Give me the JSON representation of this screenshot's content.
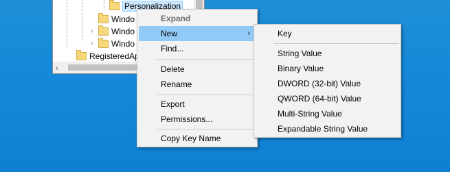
{
  "tree": {
    "items": [
      {
        "label": "Personalization"
      },
      {
        "label": "Windo"
      },
      {
        "label": "Windo"
      },
      {
        "label": "Windo"
      },
      {
        "label": "RegisteredAp"
      }
    ]
  },
  "context_menu": {
    "items": [
      {
        "label": "Expand"
      },
      {
        "label": "New"
      },
      {
        "label": "Find..."
      },
      {
        "label": "Delete"
      },
      {
        "label": "Rename"
      },
      {
        "label": "Export"
      },
      {
        "label": "Permissions..."
      },
      {
        "label": "Copy Key Name"
      }
    ]
  },
  "new_submenu": {
    "items": [
      {
        "label": "Key"
      },
      {
        "label": "String Value"
      },
      {
        "label": "Binary Value"
      },
      {
        "label": "DWORD (32-bit) Value"
      },
      {
        "label": "QWORD (64-bit) Value"
      },
      {
        "label": "Multi-String Value"
      },
      {
        "label": "Expandable String Value"
      }
    ]
  },
  "colors": {
    "desktop": "#168ad8",
    "menu_bg": "#f2f2f2",
    "highlight": "#91c9f7",
    "selection": "#cce8ff"
  },
  "icons": {
    "folder": "folder-icon",
    "expander": "chevron-right-icon",
    "submenu_arrow": "chevron-right-icon",
    "scroll_left": "chevron-left-icon"
  }
}
